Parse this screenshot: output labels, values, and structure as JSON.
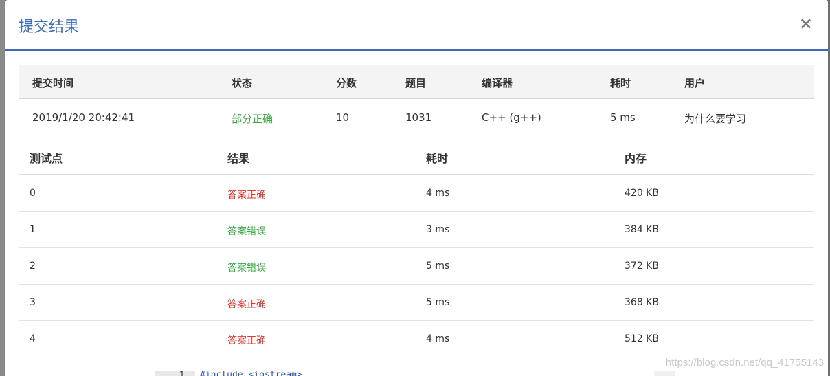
{
  "modal": {
    "title": "提交结果",
    "close_label": "×"
  },
  "summary": {
    "headers": {
      "time": "提交时间",
      "status": "状态",
      "score": "分数",
      "problem": "题目",
      "compiler": "编译器",
      "cost": "耗时",
      "user": "用户"
    },
    "row": {
      "time": "2019/1/20 20:42:41",
      "status": "部分正确",
      "score": "10",
      "problem": "1031",
      "compiler": "C++ (g++)",
      "cost": "5 ms",
      "user": "为什么要学习"
    }
  },
  "tests": {
    "headers": {
      "case": "测试点",
      "result": "结果",
      "cost": "耗时",
      "memory": "内存"
    },
    "rows": [
      {
        "case": "0",
        "result": "答案正确",
        "cost": "4 ms",
        "memory": "420 KB"
      },
      {
        "case": "1",
        "result": "答案错误",
        "cost": "3 ms",
        "memory": "384 KB"
      },
      {
        "case": "2",
        "result": "答案错误",
        "cost": "5 ms",
        "memory": "372 KB"
      },
      {
        "case": "3",
        "result": "答案正确",
        "cost": "5 ms",
        "memory": "368 KB"
      },
      {
        "case": "4",
        "result": "答案正确",
        "cost": "4 ms",
        "memory": "512 KB"
      }
    ]
  },
  "code_peek": {
    "line_number": "1",
    "text": "#include <iostream>"
  },
  "watermark": "https://blog.csdn.net/qq_41755143",
  "colors": {
    "accent": "#3f6db5",
    "correct": "#d9392f",
    "wrong": "#3aa642",
    "partial": "#3aa642"
  }
}
